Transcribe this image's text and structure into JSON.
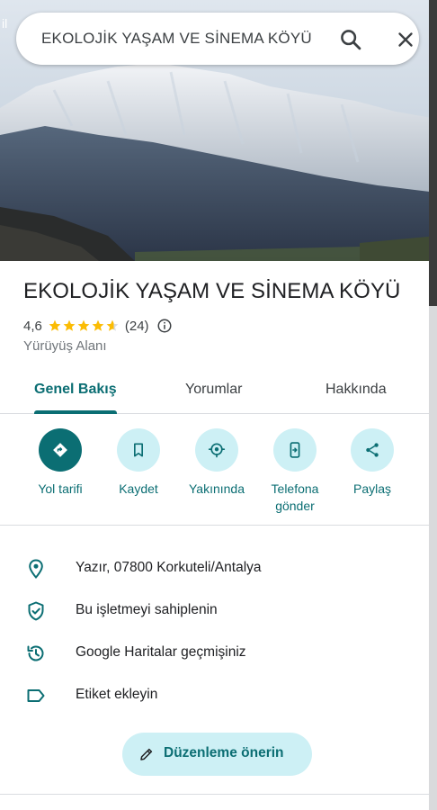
{
  "search": {
    "query": "EKOLOJİK YAŞAM VE SİNEMA KÖYÜ",
    "search_icon": "search-icon",
    "close_icon": "close-icon"
  },
  "hero": {
    "corner_text": "il",
    "description_icon": "mountain-photo"
  },
  "place": {
    "title": "EKOLOJİK YAŞAM VE SİNEMA KÖYÜ",
    "rating": "4,6",
    "stars": 4.6,
    "review_count": "(24)",
    "category": "Yürüyüş Alanı"
  },
  "tabs": [
    {
      "label": "Genel Bakış",
      "active": true
    },
    {
      "label": "Yorumlar",
      "active": false
    },
    {
      "label": "Hakkında",
      "active": false
    }
  ],
  "actions": [
    {
      "label": "Yol tarifi",
      "icon": "directions-icon"
    },
    {
      "label": "Kaydet",
      "icon": "bookmark-icon"
    },
    {
      "label": "Yakınında",
      "icon": "nearby-icon"
    },
    {
      "label": "Telefona gönder",
      "label_line1": "Telefona",
      "label_line2": "gönder",
      "icon": "send-to-phone-icon"
    },
    {
      "label": "Paylaş",
      "icon": "share-icon"
    }
  ],
  "info": [
    {
      "text": "Yazır, 07800 Korkuteli/Antalya",
      "icon": "location-pin-icon"
    },
    {
      "text": "Bu işletmeyi sahiplenin",
      "icon": "verified-shield-icon"
    },
    {
      "text": "Google Haritalar geçmişiniz",
      "icon": "history-icon"
    },
    {
      "text": "Etiket ekleyin",
      "icon": "label-icon"
    }
  ],
  "suggest_edit": {
    "label": "Düzenleme önerin",
    "icon": "pencil-icon"
  },
  "colors": {
    "accent": "#0b6e73",
    "accent_light": "#cdf0f5",
    "star": "#fbbc04",
    "text": "#202124",
    "secondary_text": "#70757a",
    "divider": "#dadce0"
  }
}
